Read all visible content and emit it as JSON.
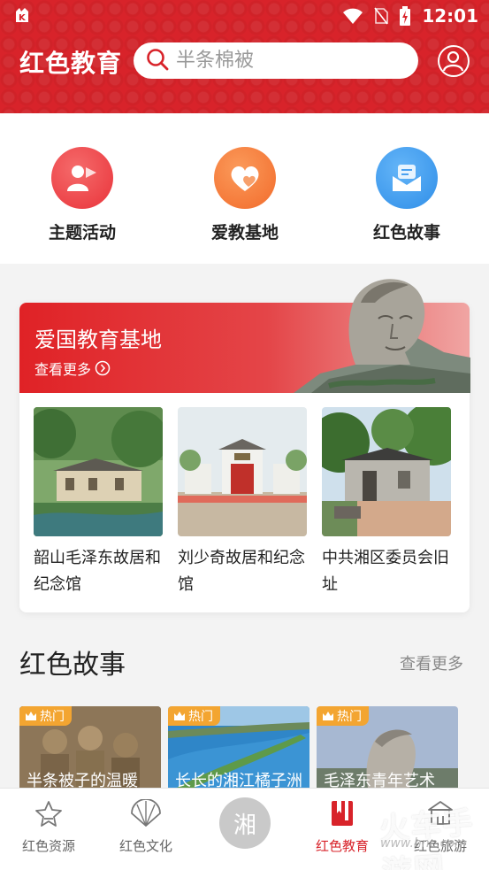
{
  "status_bar": {
    "time": "12:01",
    "app_glyph": "K"
  },
  "header": {
    "title": "红色教育",
    "search_placeholder": "半条棉被"
  },
  "quick_links": [
    {
      "label": "主题活动",
      "icon": "user-flag-icon",
      "color": "#ef4b4b"
    },
    {
      "label": "爱教基地",
      "icon": "heart-icon",
      "color": "#f57a3a"
    },
    {
      "label": "红色故事",
      "icon": "envelope-icon",
      "color": "#3d9cf0"
    }
  ],
  "base_section": {
    "title": "爱国教育基地",
    "more_label": "查看更多",
    "places": [
      {
        "name": "韶山毛泽东故居和纪念馆"
      },
      {
        "name": "刘少奇故居和纪念馆"
      },
      {
        "name": "中共湘区委员会旧址"
      }
    ]
  },
  "stories_section": {
    "title": "红色故事",
    "more_label": "查看更多",
    "items": [
      {
        "badge": "热门",
        "caption": "半条被子的温暖"
      },
      {
        "badge": "热门",
        "caption": "长长的湘江橘子洲"
      },
      {
        "badge": "热门",
        "caption": "毛泽东青年艺术"
      }
    ]
  },
  "bottom_nav": {
    "items": [
      {
        "label": "红色资源",
        "icon": "star-icon",
        "active": false
      },
      {
        "label": "红色文化",
        "icon": "fan-icon",
        "active": false
      },
      {
        "label": "湘",
        "icon": "center-logo",
        "active": false
      },
      {
        "label": "红色教育",
        "icon": "bookmark-icon",
        "active": true
      },
      {
        "label": "红色旅游",
        "icon": "temple-icon",
        "active": false
      }
    ]
  },
  "colors": {
    "brand_red": "#d8232a",
    "hot_badge": "#f3a531"
  },
  "watermark": {
    "text": "火车手游网",
    "url": "www.hnc.com"
  }
}
